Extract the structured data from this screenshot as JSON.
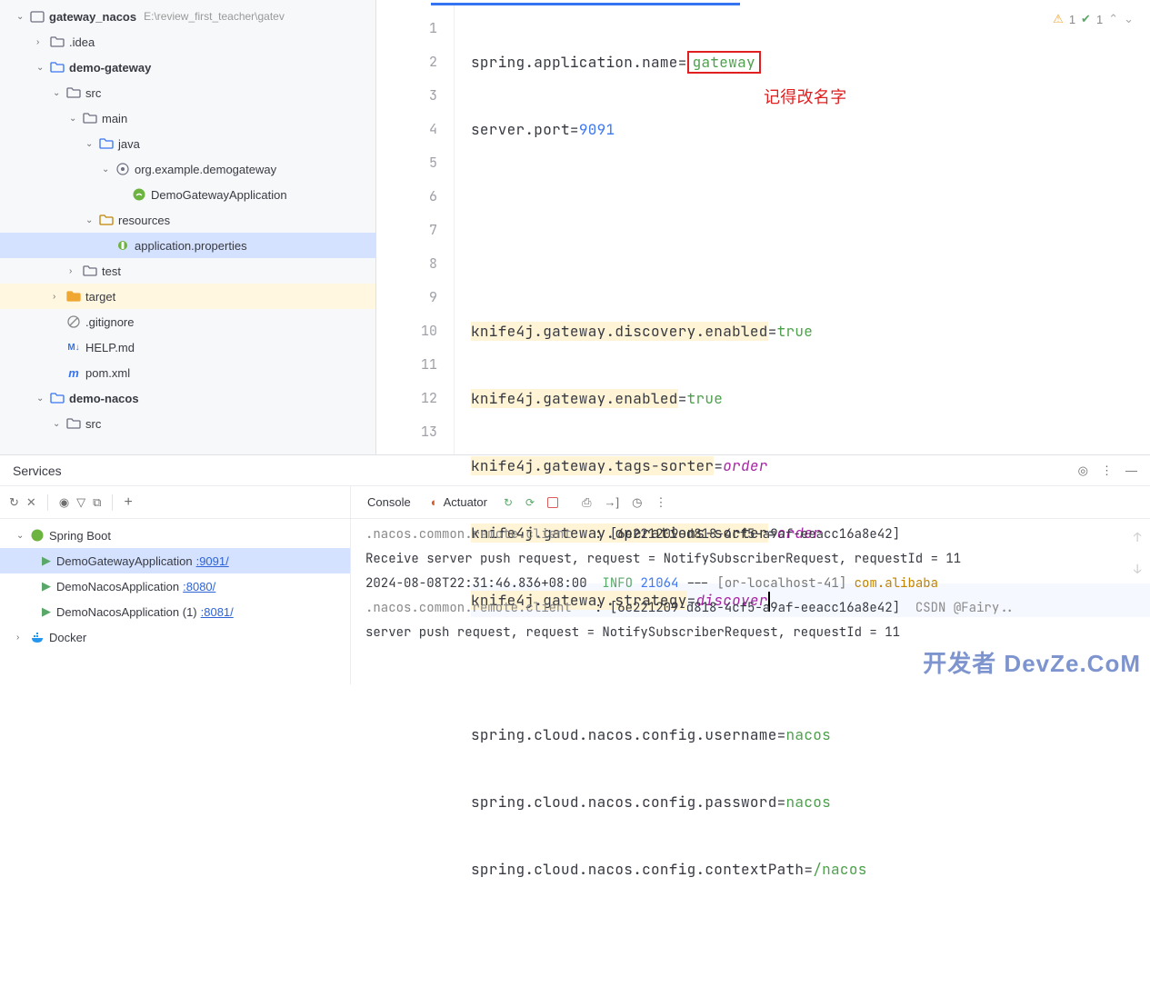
{
  "tree": {
    "root": {
      "name": "gateway_nacos",
      "path": "E:\\review_first_teacher\\gatev"
    },
    "items": {
      "idea": ".idea",
      "demoGateway": "demo-gateway",
      "src": "src",
      "main": "main",
      "java": "java",
      "pkg": "org.example.demogateway",
      "appClass": "DemoGatewayApplication",
      "resources": "resources",
      "appProps": "application.properties",
      "test": "test",
      "target": "target",
      "gitignore": ".gitignore",
      "helpmd": "HELP.md",
      "pomxml": "pom.xml",
      "demoNacos": "demo-nacos",
      "src2": "src"
    }
  },
  "editor": {
    "lines": {
      "l1k": "spring.application.name",
      "l1v": "gateway",
      "l2k": "server.port",
      "l2v": "9091",
      "l5k": "knife4j.gateway.discovery.enabled",
      "l5v": "true",
      "l6k": "knife4j.gateway.enabled",
      "l6v": "true",
      "l7k": "knife4j.gateway.tags-sorter",
      "l7v": "order",
      "l8k": "knife4j.gateway.operations-sorter",
      "l8v": "order",
      "l9k": "knife4j.gateway.strategy",
      "l9v": "discover",
      "l11k": "spring.cloud.nacos.config.username",
      "l11v": "nacos",
      "l12k": "spring.cloud.nacos.config.password",
      "l12v": "nacos",
      "l13k": "spring.cloud.nacos.config.contextPath",
      "l13v": "/nacos"
    },
    "lineNums": [
      "1",
      "2",
      "3",
      "4",
      "5",
      "6",
      "7",
      "8",
      "9",
      "10",
      "11",
      "12",
      "13"
    ],
    "annotation": "记得改名字",
    "inspections": {
      "warn": "1",
      "ok": "1"
    }
  },
  "panel": {
    "title": "Services"
  },
  "services": {
    "springBoot": "Spring Boot",
    "app1": {
      "name": "DemoGatewayApplication",
      "port": ":9091/"
    },
    "app2": {
      "name": "DemoNacosApplication",
      "port": ":8080/"
    },
    "app3": {
      "name": "DemoNacosApplication (1)",
      "port": ":8081/"
    },
    "docker": "Docker"
  },
  "console": {
    "tabConsole": "Console",
    "tabActuator": "Actuator",
    "log": {
      "pkg1": ".nacos.common.remote.client",
      "colon": "   : ",
      "id1": "[6e221209-d818-4cf5-a9af-eeacc16a8e42]",
      "recv": "Receive server push request, request = NotifySubscriberRequest, requestId = 11",
      "ts": "2024-08-08T22:31:46.836+08:00",
      "info": "INFO",
      "pid": "21064",
      "dash": " --- ",
      "thread": "[or-localhost-41]",
      "src": "com.alibaba",
      "pkg2": ".nacos.common.remote.client",
      "id2": "[6e221209-d818-4cf5-a9af-eeacc16a8e42]",
      "send2a": "server push request, request = NotifySubscriberRequest, requestId = 11",
      "csdn": "CSDN @Fairy.."
    }
  },
  "watermark": "开发者 DevZe.CoM"
}
